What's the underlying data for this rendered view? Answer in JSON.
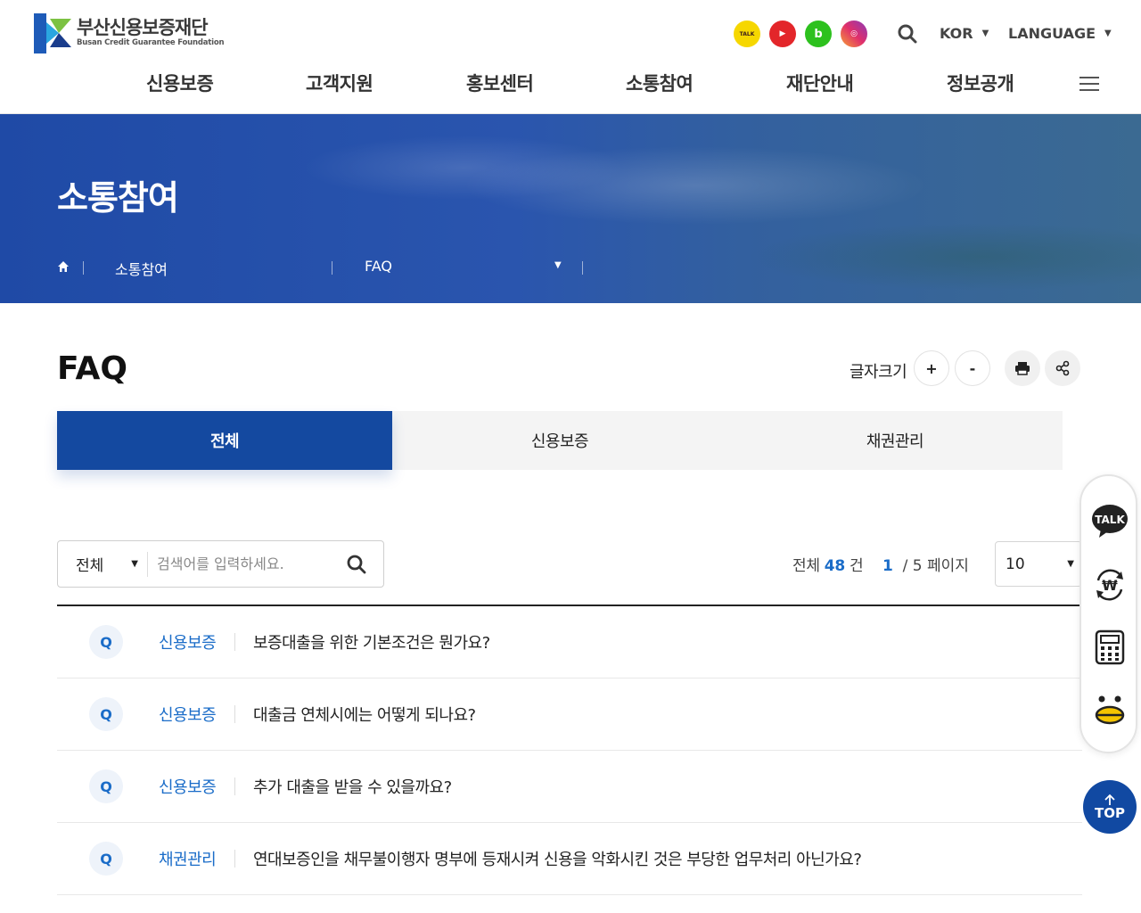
{
  "header": {
    "logo_ko": "부산신용보증재단",
    "logo_en": "Busan Credit Guarantee Foundation",
    "sns": [
      {
        "name": "kakaotalk",
        "label": "TALK"
      },
      {
        "name": "youtube",
        "label": "▶"
      },
      {
        "name": "band",
        "label": "b"
      },
      {
        "name": "instagram",
        "label": "◎"
      }
    ],
    "lang_kor": "KOR",
    "lang_en": "LANGUAGE",
    "gnb": [
      "신용보증",
      "고객지원",
      "홍보센터",
      "소통참여",
      "재단안내",
      "정보공개"
    ]
  },
  "banner": {
    "title": "소통참여",
    "breadcrumb_1": "소통참여",
    "breadcrumb_2": "FAQ"
  },
  "content": {
    "page_title": "FAQ",
    "fontsize_label": "글자크기",
    "plus": "+",
    "minus": "-",
    "tabs": [
      "전체",
      "신용보증",
      "채권관리"
    ],
    "search": {
      "select_value": "전체",
      "placeholder": "검색어를 입력하세요."
    },
    "count_prefix": "전체",
    "count_value": "48",
    "count_suffix": "건",
    "page_current": "1",
    "page_rest": "/ 5 페이지",
    "per_page": "10",
    "faq": [
      {
        "q": "Q",
        "category": "신용보증",
        "question": "보증대출을 위한 기본조건은 뭔가요?"
      },
      {
        "q": "Q",
        "category": "신용보증",
        "question": "대출금 연체시에는 어떻게 되나요?"
      },
      {
        "q": "Q",
        "category": "신용보증",
        "question": "추가 대출을 받을 수 있을까요?"
      },
      {
        "q": "Q",
        "category": "채권관리",
        "question": "연대보증인을 채무불이행자 명부에 등재시켜 신용을 악화시킨 것은 부당한 업무처리 아닌가요?"
      }
    ]
  },
  "quick": {
    "top_label": "TOP",
    "talk_label": "TALK"
  }
}
